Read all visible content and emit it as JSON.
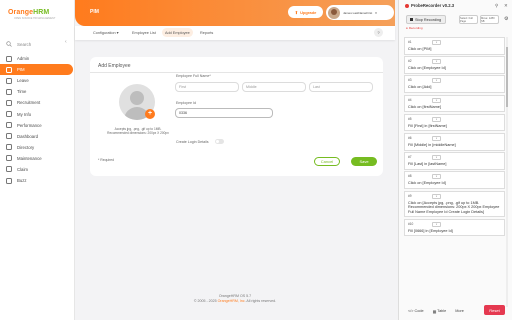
{
  "brand": {
    "orange": "Orange",
    "hrm": "HRM",
    "sub": "OPEN SOURCE HR MANAGEMENT"
  },
  "search": {
    "placeholder": "Search"
  },
  "nav": [
    "Admin",
    "PIM",
    "Leave",
    "Time",
    "Recruitment",
    "My Info",
    "Performance",
    "Dashboard",
    "Directory",
    "Maintenance",
    "Claim",
    "Buzz"
  ],
  "topbar": {
    "title": "PIM",
    "upgrade": "Upgrade",
    "user": "James LastNameFirst"
  },
  "tabs": [
    "Configuration",
    "Employee List",
    "Add Employee",
    "Reports"
  ],
  "help": "?",
  "form": {
    "title": "Add Employee",
    "photo_hint": "Accepts jpg, .png, .gif up to 1MB. Recommended dimensions: 200px X 200px",
    "full_name_label": "Employee Full Name*",
    "first_placeholder": "First",
    "middle_placeholder": "Middle",
    "last_placeholder": "Last",
    "employee_id_label": "Employee Id",
    "employee_id_value": "0336",
    "create_login": "Create Login Details",
    "required": "* Required",
    "cancel": "Cancel",
    "save": "Save"
  },
  "footer": {
    "line1": "OrangeHRM OS 5.7",
    "line2_pre": "© 2005 - 2025 ",
    "line2_link": "OrangeHRM, Inc",
    "line2_post": ". All rights reserved."
  },
  "recorder": {
    "title": "ProbeRecorder v0.2.3",
    "stop": "Stop Recording",
    "status": "Recording",
    "menu1": "Select: Full Page",
    "menu2": "Move: 1280 SB",
    "steps": [
      {
        "num": "#1",
        "text": "Click on [PIM]"
      },
      {
        "num": "#2",
        "text": "Click on [Employee Id]"
      },
      {
        "num": "#3",
        "text": "Click on [Add]"
      },
      {
        "num": "#4",
        "text": "Click on [firstName]"
      },
      {
        "num": "#5",
        "text": "Fill [First] in [firstName]"
      },
      {
        "num": "#6",
        "text": "Fill [Middle] in [middleName]"
      },
      {
        "num": "#7",
        "text": "Fill [Last] in [lastName]"
      },
      {
        "num": "#8",
        "text": "Click on [Employee Id]"
      },
      {
        "num": "#9",
        "text": "Click on [Accepts jpg, .png, .gif up to 1MB. Recommended dimensions: 200px X 200px Employee Full Name Employee Id Create Login Details]"
      },
      {
        "num": "#10",
        "text": "Fill [0666] in [Employee Id]"
      }
    ],
    "code": "Code",
    "table": "Table",
    "more": "More",
    "reset": "Reset"
  }
}
